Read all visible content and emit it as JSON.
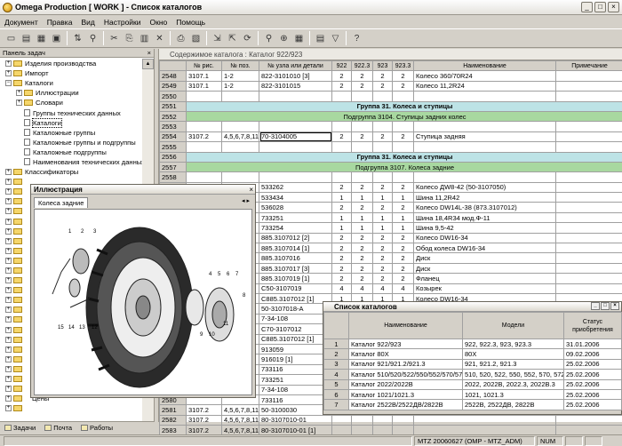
{
  "window": {
    "title": "Omega Production [ WORK ] - Список каталогов",
    "min": "_",
    "max": "□",
    "close": "×"
  },
  "menu": [
    "Документ",
    "Правка",
    "Вид",
    "Настройки",
    "Окно",
    "Помощь"
  ],
  "left_panel": {
    "title": "Панель задач",
    "close": "×",
    "tree": [
      {
        "label": "Изделия производства",
        "level": 0,
        "toggle": "+",
        "icon": "folder"
      },
      {
        "label": "Импорт",
        "level": 0,
        "toggle": "+",
        "icon": "folder"
      },
      {
        "label": "Каталоги",
        "level": 0,
        "toggle": "−",
        "icon": "folder"
      },
      {
        "label": "Иллюстрации",
        "level": 1,
        "toggle": "+",
        "icon": "folder"
      },
      {
        "label": "Словари",
        "level": 1,
        "toggle": "+",
        "icon": "folder"
      },
      {
        "label": "Группы технических данных",
        "level": 1,
        "toggle": "",
        "icon": "doc"
      },
      {
        "label": "Каталоги",
        "level": 1,
        "toggle": "",
        "icon": "doc",
        "selected": true
      },
      {
        "label": "Каталожные группы",
        "level": 1,
        "toggle": "",
        "icon": "doc"
      },
      {
        "label": "Каталожные группы и подгруппы",
        "level": 1,
        "toggle": "",
        "icon": "doc"
      },
      {
        "label": "Каталожные подгруппы",
        "level": 1,
        "toggle": "",
        "icon": "doc"
      },
      {
        "label": "Наименования технических данных",
        "level": 1,
        "toggle": "",
        "icon": "doc"
      },
      {
        "label": "Классификаторы",
        "level": 0,
        "toggle": "+",
        "icon": "folder"
      }
    ],
    "bottom_label": "Цены",
    "tabs": [
      "Задачи",
      "Почта",
      "Работы"
    ]
  },
  "catalog": {
    "header": "Содержимое каталога : Каталог 922/923",
    "columns": [
      "№ рис.",
      "№ поз.",
      "№ узла или детали",
      "922",
      "922.3",
      "923",
      "923.3",
      "Наименование",
      "Примечание"
    ],
    "rows": [
      {
        "n": "2548",
        "c": [
          "3107.1",
          "1-2",
          "822-3101010 [3]",
          "2",
          "2",
          "2",
          "2",
          "Колесо 360/70R24",
          ""
        ]
      },
      {
        "n": "2549",
        "c": [
          "3107.1",
          "1-2",
          "822-3101015",
          "2",
          "2",
          "2",
          "2",
          "Колесо 11,2R24",
          ""
        ]
      },
      {
        "n": "2550",
        "c": [
          "",
          "",
          "",
          "",
          "",
          "",
          "",
          "",
          ""
        ]
      },
      {
        "n": "2551",
        "group": "Группа 31. Колеса и ступицы",
        "style": 1
      },
      {
        "n": "2552",
        "group": "Подгруппа 3104. Ступицы задних колес",
        "style": 2
      },
      {
        "n": "2553",
        "c": [
          "",
          "",
          "",
          "",
          "",
          "",
          "",
          "",
          ""
        ]
      },
      {
        "n": "2554",
        "c": [
          "3107.2",
          "4,5,6,7,8,11",
          "70-3104005",
          "2",
          "2",
          "2",
          "2",
          "Ступица задняя",
          ""
        ],
        "edit": true
      },
      {
        "n": "2555",
        "c": [
          "",
          "",
          "",
          "",
          "",
          "",
          "",
          "",
          ""
        ]
      },
      {
        "n": "2556",
        "group": "Группа 31. Колеса и ступицы",
        "style": 1
      },
      {
        "n": "2557",
        "group": "Подгруппа 3107. Колеса задние",
        "style": 2
      },
      {
        "n": "2558",
        "c": [
          "",
          "",
          "",
          "",
          "",
          "",
          "",
          "",
          ""
        ]
      },
      {
        "n": "2559",
        "c": [
          "",
          "",
          "533262",
          "2",
          "2",
          "2",
          "2",
          "Колесо ДW8-42 (50-3107050)",
          ""
        ]
      },
      {
        "n": "2560",
        "c": [
          "",
          "",
          "533434",
          "1",
          "1",
          "1",
          "1",
          "Шина 11,2R42",
          ""
        ]
      },
      {
        "n": "2561",
        "c": [
          "",
          "",
          "536028",
          "2",
          "2",
          "2",
          "2",
          "Колесо DW14L-38 (873.3107012)",
          ""
        ]
      },
      {
        "n": "2562",
        "c": [
          "",
          "",
          "733251",
          "1",
          "1",
          "1",
          "1",
          "Шина 18,4R34 мод.Ф-11",
          ""
        ]
      },
      {
        "n": "2563",
        "c": [
          "",
          "",
          "733254",
          "1",
          "1",
          "1",
          "1",
          "Шина 9,5-42",
          ""
        ]
      },
      {
        "n": "2564",
        "c": [
          "",
          "",
          "885.3107012 [2]",
          "2",
          "2",
          "2",
          "2",
          "Колесо DW16-34",
          ""
        ]
      },
      {
        "n": "2565",
        "c": [
          "",
          "",
          "885.3107014 [1]",
          "2",
          "2",
          "2",
          "2",
          "Обод колеса DW16-34",
          ""
        ]
      },
      {
        "n": "2566",
        "c": [
          "",
          "",
          "885.3107016",
          "2",
          "2",
          "2",
          "2",
          "Диск",
          ""
        ]
      },
      {
        "n": "2567",
        "c": [
          "",
          "",
          "885.3107017 [3]",
          "2",
          "2",
          "2",
          "2",
          "Диск",
          ""
        ]
      },
      {
        "n": "2568",
        "c": [
          "",
          "",
          "885.3107019 [1]",
          "2",
          "2",
          "2",
          "2",
          "Фланец",
          ""
        ]
      },
      {
        "n": "2569",
        "c": [
          "",
          "",
          "C50-3107019",
          "4",
          "4",
          "4",
          "4",
          "Козырек",
          ""
        ]
      },
      {
        "n": "2570",
        "c": [
          "",
          "",
          "C885.3107012 [1]",
          "1",
          "1",
          "1",
          "1",
          "Колесо DW16-34",
          ""
        ]
      },
      {
        "n": "2571",
        "c": [
          "",
          "",
          "50-3107018-A",
          "",
          "",
          "",
          "",
          "",
          ""
        ]
      },
      {
        "n": "2572",
        "c": [
          "",
          "",
          "7-34-108",
          "",
          "",
          "",
          "",
          "",
          ""
        ]
      },
      {
        "n": "2573",
        "c": [
          "",
          "",
          "C70-3107012",
          "",
          "",
          "",
          "",
          "",
          ""
        ]
      },
      {
        "n": "2574",
        "c": [
          "",
          "",
          "C885.3107012 [1]",
          "",
          "",
          "",
          "",
          "",
          ""
        ]
      },
      {
        "n": "2575",
        "c": [
          "",
          "",
          "913059",
          "",
          "",
          "",
          "",
          "",
          ""
        ]
      },
      {
        "n": "2576",
        "c": [
          "",
          "",
          "916019 [1]",
          "",
          "",
          "",
          "",
          "",
          ""
        ]
      },
      {
        "n": "2577",
        "c": [
          "",
          "",
          "733116",
          "",
          "",
          "",
          "",
          "",
          ""
        ]
      },
      {
        "n": "2578",
        "c": [
          "",
          "",
          "733251",
          "",
          "",
          "",
          "",
          "",
          ""
        ]
      },
      {
        "n": "2579",
        "c": [
          "",
          "",
          "7-34-108",
          "",
          "",
          "",
          "",
          "",
          ""
        ]
      },
      {
        "n": "2580",
        "c": [
          "",
          "",
          "733116",
          "",
          "",
          "",
          "",
          "",
          ""
        ]
      },
      {
        "n": "2581",
        "c": [
          "3107.2",
          "4,5,6,7,8,11",
          "50-3100030",
          "",
          "",
          "",
          "",
          "",
          ""
        ]
      },
      {
        "n": "2582",
        "c": [
          "3107.2",
          "4,5,6,7,8,11",
          "80-3107010-01",
          "",
          "",
          "",
          "",
          "",
          ""
        ]
      },
      {
        "n": "2583",
        "c": [
          "3107.2",
          "4,5,6,7,8,11",
          "80-3107010-01 [1]",
          "",
          "",
          "",
          "",
          "",
          ""
        ]
      },
      {
        "n": "2584",
        "c": [
          "3107.2",
          "4,5,6,7,8,11",
          "80-3107010-02",
          "",
          "",
          "",
          "",
          "",
          ""
        ]
      }
    ]
  },
  "illustration": {
    "title": "Иллюстрация",
    "close": "×",
    "tab": "Колеса задние",
    "nav": "◂ ▸",
    "callouts": [
      "1",
      "2",
      "3",
      "4",
      "5",
      "6",
      "7",
      "8",
      "9",
      "10",
      "11",
      "12",
      "13",
      "14",
      "15"
    ]
  },
  "catalog_list": {
    "title": "Список каталогов",
    "columns": [
      "Наименование",
      "Модели",
      "Статус приобретения"
    ],
    "rows": [
      {
        "n": "1",
        "name": "Каталог 922/923",
        "models": "922, 922.3, 923, 923.3",
        "date": "31.01.2006"
      },
      {
        "n": "2",
        "name": "Каталог 80Х",
        "models": "80Х",
        "date": "09.02.2006"
      },
      {
        "n": "3",
        "name": "Каталог 921/921.2/921.3",
        "models": "921, 921.2, 921.3",
        "date": "25.02.2006"
      },
      {
        "n": "4",
        "name": "Каталог 510/520/522/550/552/570/572",
        "models": "510, 520, 522, 550, 552, 570, 572",
        "date": "25.02.2006"
      },
      {
        "n": "5",
        "name": "Каталог 2022/2022В",
        "models": "2022, 2022В, 2022.3, 2022В.3",
        "date": "25.02.2006"
      },
      {
        "n": "6",
        "name": "Каталог 1021/1021.3",
        "models": "1021, 1021.3",
        "date": "25.02.2006"
      },
      {
        "n": "7",
        "name": "Каталог 2522В/2522ДВ/2822В",
        "models": "2522В, 2522ДВ, 2822В",
        "date": "25.02.2006"
      }
    ]
  },
  "status": {
    "db": "MTZ 20060627 (OMP - MTZ_ADM)",
    "num": "NUM"
  }
}
